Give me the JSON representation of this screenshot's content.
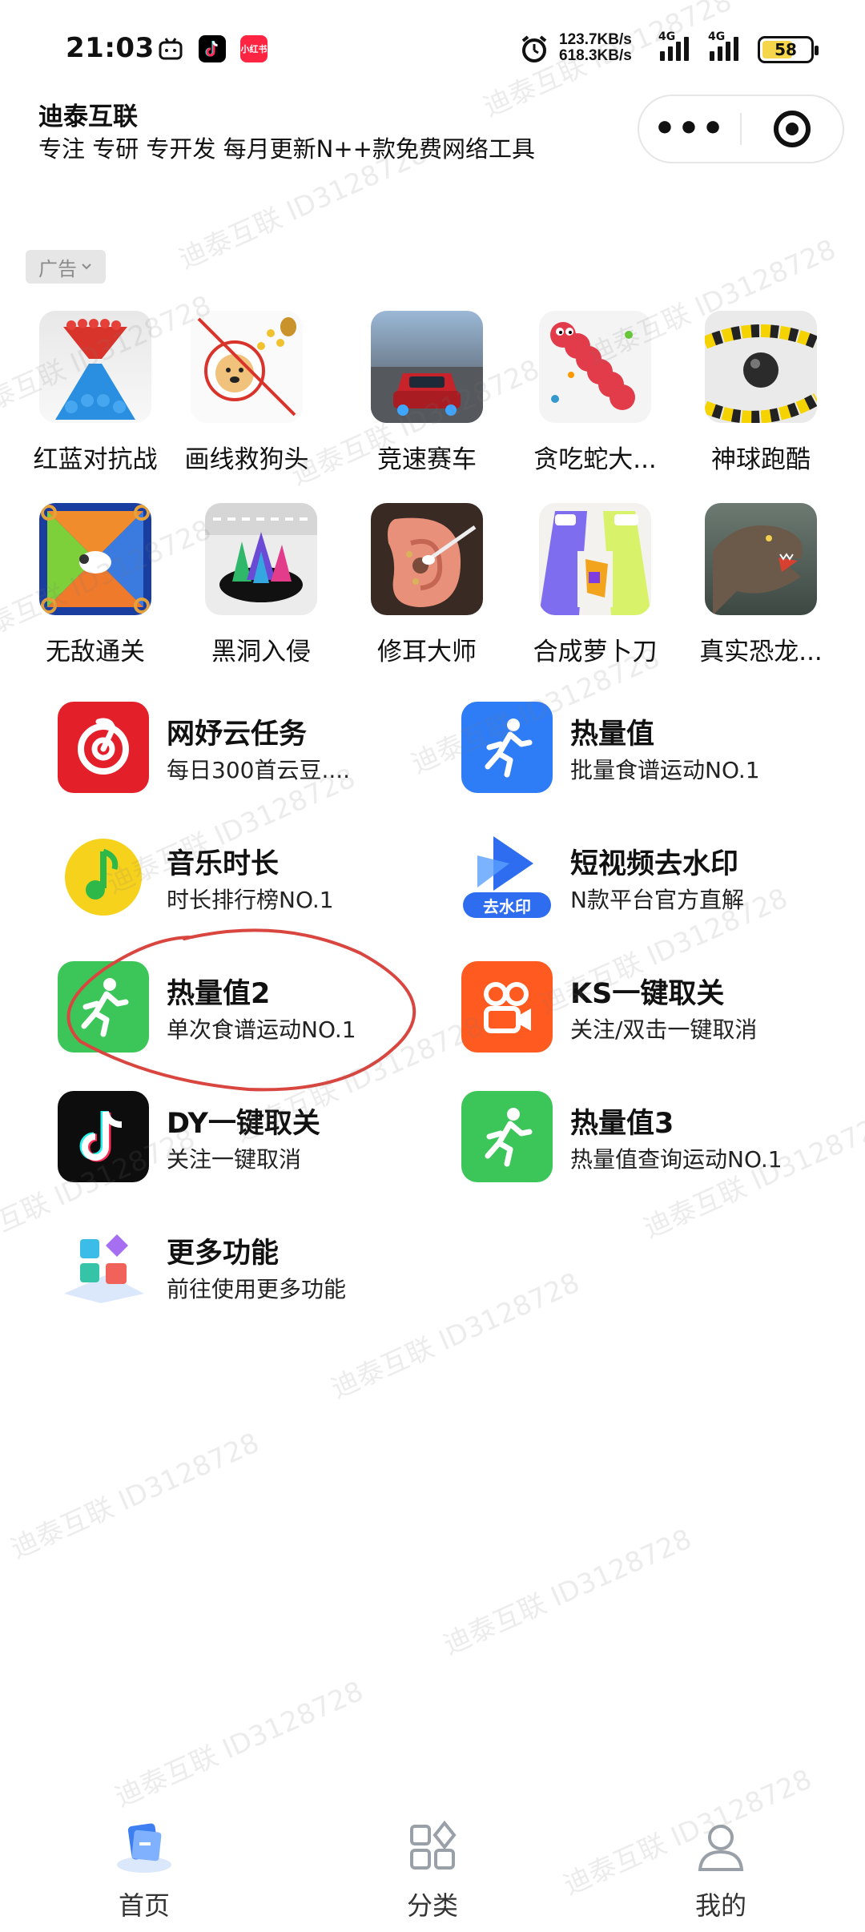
{
  "status_bar": {
    "time": "21:03",
    "speed_up": "123.7KB/s",
    "speed_down": "618.3KB/s",
    "network1": "4G",
    "network2": "4G",
    "battery": "58",
    "notif_icons": [
      "bilibili-icon",
      "tiktok-icon",
      "xiaohongshu-icon"
    ],
    "xhs_label": "小红书"
  },
  "header": {
    "title": "迪泰互联",
    "subtitle": "专注 专研 专开发 每月更新N++款免费网络工具",
    "more_glyph": "•••"
  },
  "ad": {
    "label": "广告"
  },
  "games": [
    {
      "name": "红蓝对抗战",
      "icon": "crowd-game-icon"
    },
    {
      "name": "画线救狗头",
      "icon": "doge-game-icon"
    },
    {
      "name": "竞速赛车",
      "icon": "race-car-icon"
    },
    {
      "name": "贪吃蛇大...",
      "icon": "snake-icon"
    },
    {
      "name": "神球跑酷",
      "icon": "ball-run-icon"
    },
    {
      "name": "无敌通关",
      "icon": "sheep-puzzle-icon"
    },
    {
      "name": "黑洞入侵",
      "icon": "black-hole-icon"
    },
    {
      "name": "修耳大师",
      "icon": "ear-cleaning-icon"
    },
    {
      "name": "合成萝卜刀",
      "icon": "carrot-knife-icon"
    },
    {
      "name": "真实恐龙...",
      "icon": "dinosaur-icon"
    }
  ],
  "tools": [
    {
      "title": "网妤云任务",
      "desc": "每日300首云豆....",
      "icon": "netease-music-icon",
      "color": "#e3202a"
    },
    {
      "title": "热量值",
      "desc": "批量食谱运动NO.1",
      "icon": "running-icon",
      "color": "#2f7df6"
    },
    {
      "title": "音乐时长",
      "desc": "时长排行榜NO.1",
      "icon": "qq-music-icon",
      "color": "#f7d21c"
    },
    {
      "title": "短视频去水印",
      "desc": "N款平台官方直解",
      "icon": "remove-watermark-icon",
      "color": "#2f6df0",
      "badge": "去水印"
    },
    {
      "title": "热量值2",
      "desc": "单次食谱运动NO.1",
      "icon": "running-icon",
      "color": "#3cc65a"
    },
    {
      "title": "KS一键取关",
      "desc": "关注/双击一键取消",
      "icon": "kuaishou-icon",
      "color": "#ff5a1f"
    },
    {
      "title": "DY一键取关",
      "desc": "关注一键取消",
      "icon": "douyin-icon",
      "color": "#0d0d0d"
    },
    {
      "title": "热量值3",
      "desc": "热量值查询运动NO.1",
      "icon": "running-icon",
      "color": "#3cc65a"
    },
    {
      "title": "更多功能",
      "desc": "前往使用更多功能",
      "icon": "more-apps-icon",
      "color": "#ffffff"
    }
  ],
  "nav": [
    {
      "label": "首页",
      "icon": "home-icon",
      "active": true
    },
    {
      "label": "分类",
      "icon": "category-icon",
      "active": false
    },
    {
      "label": "我的",
      "icon": "profile-icon",
      "active": false
    }
  ],
  "watermark": "迪泰互联 ID3128728",
  "colors": {
    "annotation_circle": "#d9453f",
    "ad_tag_bg": "#e6e6e6"
  }
}
